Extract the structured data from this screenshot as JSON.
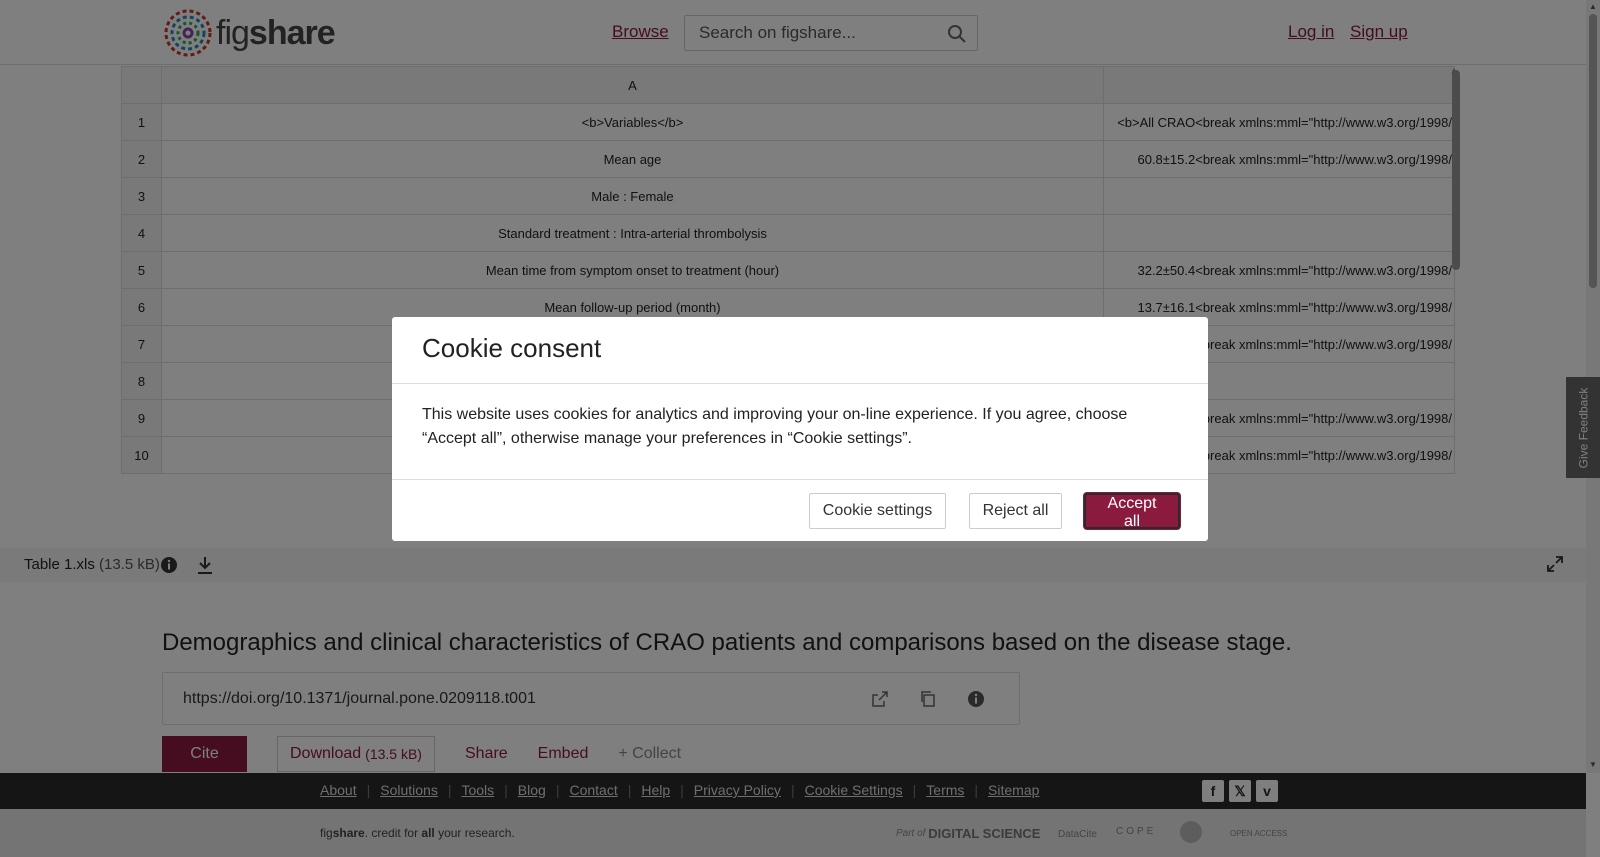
{
  "header": {
    "logo_text_light": "fig",
    "logo_text_bold": "share",
    "browse_label": "Browse",
    "search_placeholder": "Search on figshare...",
    "login_label": "Log in",
    "signup_label": "Sign up"
  },
  "sheet": {
    "column_headers": [
      "A",
      ""
    ],
    "rows": [
      {
        "num": "1",
        "a": "<b>Variables</b>",
        "b": "<b>All CRAO<break xmlns:mml=\"http://www.w3.org/1998/"
      },
      {
        "num": "2",
        "a": "Mean age",
        "b": "60.8±15.2<break xmlns:mml=\"http://www.w3.org/1998/"
      },
      {
        "num": "3",
        "a": "Male : Female",
        "b": ""
      },
      {
        "num": "4",
        "a": "Standard treatment : Intra-arterial thrombolysis",
        "b": ""
      },
      {
        "num": "5",
        "a": "Mean time from symptom onset to treatment (hour)",
        "b": "32.2±50.4<break xmlns:mml=\"http://www.w3.org/1998/"
      },
      {
        "num": "6",
        "a": "Mean follow-up period (month)",
        "b": "13.7±16.1<break xmlns:mml=\"http://www.w3.org/1998/"
      },
      {
        "num": "7",
        "a": "",
        "b": "<break xmlns:mml=\"http://www.w3.org/1998/"
      },
      {
        "num": "8",
        "a": "",
        "b": ""
      },
      {
        "num": "9",
        "a": "",
        "b": "<break xmlns:mml=\"http://www.w3.org/1998/"
      },
      {
        "num": "10",
        "a": "",
        "b": "<break xmlns:mml=\"http://www.w3.org/1998/"
      }
    ]
  },
  "filebar": {
    "filename": "Table 1.xls",
    "filesize": "(13.5 kB)"
  },
  "content": {
    "title": "Demographics and clinical characteristics of CRAO patients and comparisons based on the disease stage.",
    "doi": "https://doi.org/10.1371/journal.pone.0209118.t001",
    "cite_label": "Cite",
    "download_label": "Download",
    "download_size": "(13.5 kB)",
    "share_label": "Share",
    "embed_label": "Embed",
    "collect_label": "+ Collect"
  },
  "footer": {
    "links": [
      "About",
      "Solutions",
      "Tools",
      "Blog",
      "Contact",
      "Help",
      "Privacy Policy",
      "Cookie Settings",
      "Terms",
      "Sitemap"
    ],
    "tagline_pre": "fig",
    "tagline_bold": "share",
    "tagline_mid": ". credit for ",
    "tagline_all": "all",
    "tagline_post": " your research.",
    "partner_label": "Part of",
    "partner_brand": "DIGITAL SCIENCE",
    "datacite": "DataCite",
    "cope": "COPE",
    "open_access": "OPEN ACCESS",
    "social_icons": [
      "facebook-icon",
      "x-icon",
      "vimeo-icon"
    ]
  },
  "feedback_label": "Give Feedback",
  "modal": {
    "title": "Cookie consent",
    "body": "This website uses cookies for analytics and improving your on-line experience. If you agree, choose “Accept all”, otherwise manage your preferences in “Cookie settings”.",
    "settings_label": "Cookie settings",
    "reject_label": "Reject all",
    "accept_label": "Accept all"
  },
  "colors": {
    "brand": "#8b1a3f",
    "footer_dark": "#2b2b2b"
  }
}
